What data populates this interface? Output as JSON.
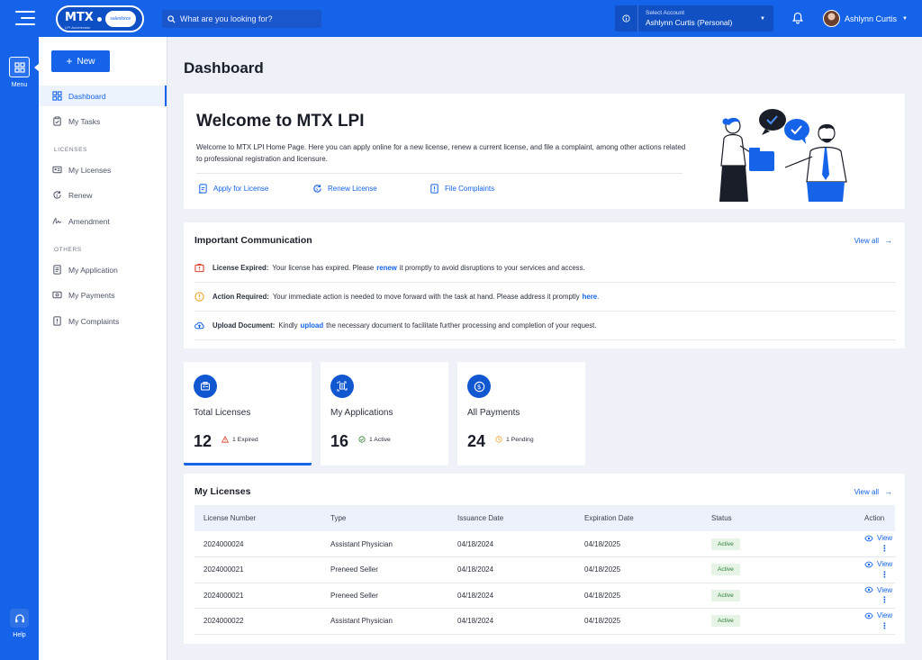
{
  "header": {
    "logo_text": "MTX",
    "logo_sub": "LPI Accelerator",
    "logo_partner": "salesforce",
    "search_placeholder": "What are you looking for?",
    "account_label": "Select Account",
    "account_value": "Ashlynn Curtis (Personal)",
    "user_name": "Ashlynn Curtis"
  },
  "rail": {
    "menu_label": "Menu",
    "help_label": "Help"
  },
  "sidebar": {
    "new_label": "New",
    "items": [
      {
        "label": "Dashboard"
      },
      {
        "label": "My Tasks"
      }
    ],
    "section_licenses": "LICENSES",
    "license_items": [
      {
        "label": "My Licenses"
      },
      {
        "label": "Renew"
      },
      {
        "label": "Amendment"
      }
    ],
    "section_others": "OTHERS",
    "other_items": [
      {
        "label": "My Application"
      },
      {
        "label": "My Payments"
      },
      {
        "label": "My Complaints"
      }
    ]
  },
  "page": {
    "title": "Dashboard"
  },
  "welcome": {
    "title": "Welcome to MTX LPI",
    "text": "Welcome to MTX LPI Home Page. Here you can apply online for a new license, renew a current license, and file a complaint, among other actions related to professional registration and licensure.",
    "links": [
      "Apply for License",
      "Renew License",
      "File Complaints"
    ]
  },
  "communication": {
    "title": "Important Communication",
    "view_all": "View all",
    "rows": [
      {
        "label": "License Expired:",
        "before": "Your license has expired. Please",
        "link": "renew",
        "after": "it promptly to avoid disruptions to your services and access."
      },
      {
        "label": "Action Required:",
        "before": "Your immediate action is needed to move forward with the task at hand. Please address it promptly",
        "link": "here",
        "after": "."
      },
      {
        "label": "Upload Document:",
        "before": "Kindly",
        "link": "upload",
        "after": "the necessary document to facilitate further processing and completion of your request."
      }
    ]
  },
  "stats": [
    {
      "label": "Total Licenses",
      "value": "12",
      "badge": "1 Expired"
    },
    {
      "label": "My Applications",
      "value": "16",
      "badge": "1 Active"
    },
    {
      "label": "All Payments",
      "value": "24",
      "badge": "1 Pending"
    }
  ],
  "licenses": {
    "title": "My Licenses",
    "view_all": "View all",
    "columns": [
      "License Number",
      "Type",
      "Issuance Date",
      "Expiration Date",
      "Status",
      "Action"
    ],
    "rows": [
      {
        "number": "2024000024",
        "type": "Assistant Physician",
        "issued": "04/18/2024",
        "expires": "04/18/2025",
        "status": "Active",
        "action": "View"
      },
      {
        "number": "2024000021",
        "type": "Preneed Seller",
        "issued": "04/18/2024",
        "expires": "04/18/2025",
        "status": "Active",
        "action": "View"
      },
      {
        "number": "2024000021",
        "type": "Preneed Seller",
        "issued": "04/18/2024",
        "expires": "04/18/2025",
        "status": "Active",
        "action": "View"
      },
      {
        "number": "2024000022",
        "type": "Assistant Physician",
        "issued": "04/18/2024",
        "expires": "04/18/2025",
        "status": "Active",
        "action": "View"
      }
    ]
  },
  "colors": {
    "primary": "#1463e8",
    "background": "#eef2f8",
    "success": "#2e7d32",
    "warning": "#f0a32a",
    "danger": "#d9432f"
  }
}
